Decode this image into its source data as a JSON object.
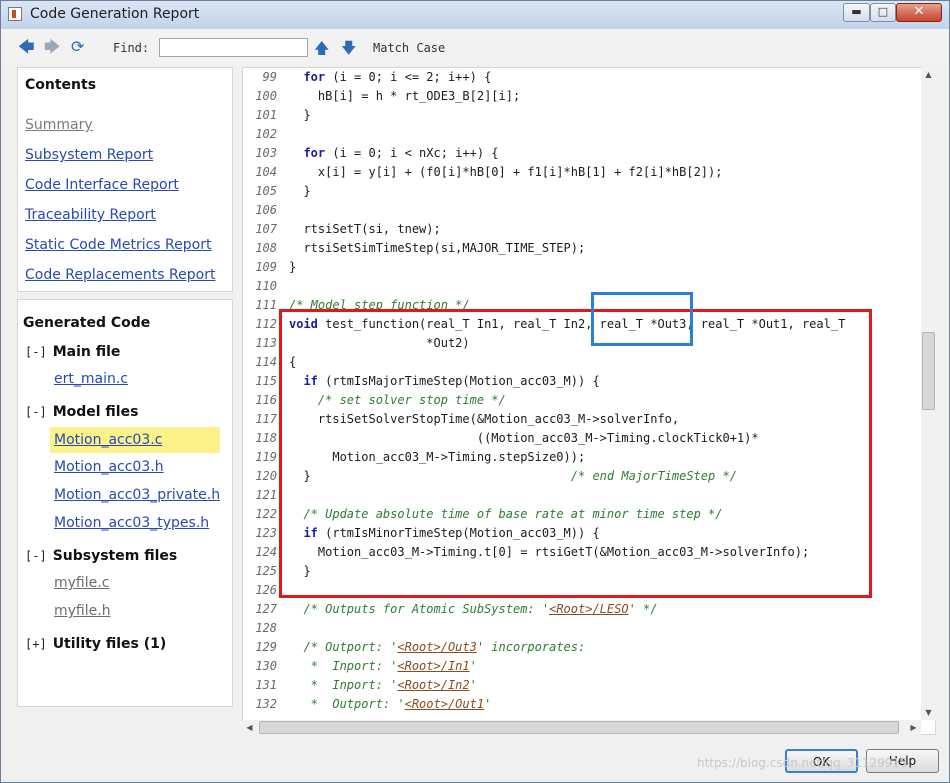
{
  "window": {
    "title": "Code Generation Report"
  },
  "toolbar": {
    "find_label": "Find:",
    "find_value": "",
    "match_case": "Match Case"
  },
  "contents": {
    "heading": "Contents",
    "links": [
      {
        "label": "Summary"
      },
      {
        "label": "Subsystem Report"
      },
      {
        "label": "Code Interface Report"
      },
      {
        "label": "Traceability Report"
      },
      {
        "label": "Static Code Metrics Report"
      },
      {
        "label": "Code Replacements Report"
      }
    ]
  },
  "generated": {
    "heading": "Generated Code",
    "groups": [
      {
        "toggle": "[-]",
        "label": "Main file",
        "files": [
          "ert_main.c"
        ]
      },
      {
        "toggle": "[-]",
        "label": "Model files",
        "files": [
          "Motion_acc03.c",
          "Motion_acc03.h",
          "Motion_acc03_private.h",
          "Motion_acc03_types.h"
        ]
      },
      {
        "toggle": "[-]",
        "label": "Subsystem files",
        "files": [
          "myfile.c",
          "myfile.h"
        ]
      },
      {
        "toggle": "[+]",
        "label": "Utility files (1)",
        "files": []
      }
    ]
  },
  "code": {
    "lines": [
      {
        "n": "99",
        "t": "  for (i = 0; i <= 2; i++) {"
      },
      {
        "n": "100",
        "t": "    hB[i] = h * rt_ODE3_B[2][i];"
      },
      {
        "n": "101",
        "t": "  }"
      },
      {
        "n": "102",
        "t": ""
      },
      {
        "n": "103",
        "t": "  for (i = 0; i < nXc; i++) {"
      },
      {
        "n": "104",
        "t": "    x[i] = y[i] + (f0[i]*hB[0] + f1[i]*hB[1] + f2[i]*hB[2]);"
      },
      {
        "n": "105",
        "t": "  }"
      },
      {
        "n": "106",
        "t": ""
      },
      {
        "n": "107",
        "t": "  rtsiSetT(si, tnew);"
      },
      {
        "n": "108",
        "t": "  rtsiSetSimTimeStep(si,MAJOR_TIME_STEP);"
      },
      {
        "n": "109",
        "t": "}"
      },
      {
        "n": "110",
        "t": ""
      },
      {
        "n": "111",
        "t": "/* Model step function */"
      },
      {
        "n": "112",
        "t": "void test_function(real_T In1, real_T In2, real_T *Out3, real_T *Out1, real_T"
      },
      {
        "n": "113",
        "t": "                   *Out2)"
      },
      {
        "n": "114",
        "t": "{"
      },
      {
        "n": "115",
        "t": "  if (rtmIsMajorTimeStep(Motion_acc03_M)) {"
      },
      {
        "n": "116",
        "t": "    /* set solver stop time */"
      },
      {
        "n": "117",
        "t": "    rtsiSetSolverStopTime(&Motion_acc03_M->solverInfo,"
      },
      {
        "n": "118",
        "t": "                          ((Motion_acc03_M->Timing.clockTick0+1)*"
      },
      {
        "n": "119",
        "t": "      Motion_acc03_M->Timing.stepSize0));"
      },
      {
        "n": "120",
        "t": "  }                                    /* end MajorTimeStep */"
      },
      {
        "n": "121",
        "t": ""
      },
      {
        "n": "122",
        "t": "  /* Update absolute time of base rate at minor time step */"
      },
      {
        "n": "123",
        "t": "  if (rtmIsMinorTimeStep(Motion_acc03_M)) {"
      },
      {
        "n": "124",
        "t": "    Motion_acc03_M->Timing.t[0] = rtsiGetT(&Motion_acc03_M->solverInfo);"
      },
      {
        "n": "125",
        "t": "  }"
      },
      {
        "n": "126",
        "t": ""
      },
      {
        "n": "127",
        "t": "  /* Outputs for Atomic SubSystem: '<Root>/LESO' */"
      },
      {
        "n": "128",
        "t": ""
      },
      {
        "n": "129",
        "t": "  /* Outport: '<Root>/Out3' incorporates:"
      },
      {
        "n": "130",
        "t": "   *  Inport: '<Root>/In1'"
      },
      {
        "n": "131",
        "t": "   *  Inport: '<Root>/In2'"
      },
      {
        "n": "132",
        "t": "   *  Outport: '<Root>/Out1'"
      }
    ]
  },
  "buttons": {
    "ok": "OK",
    "help": "Help"
  },
  "watermark": "https://blog.csdn.net/qq_31129915"
}
